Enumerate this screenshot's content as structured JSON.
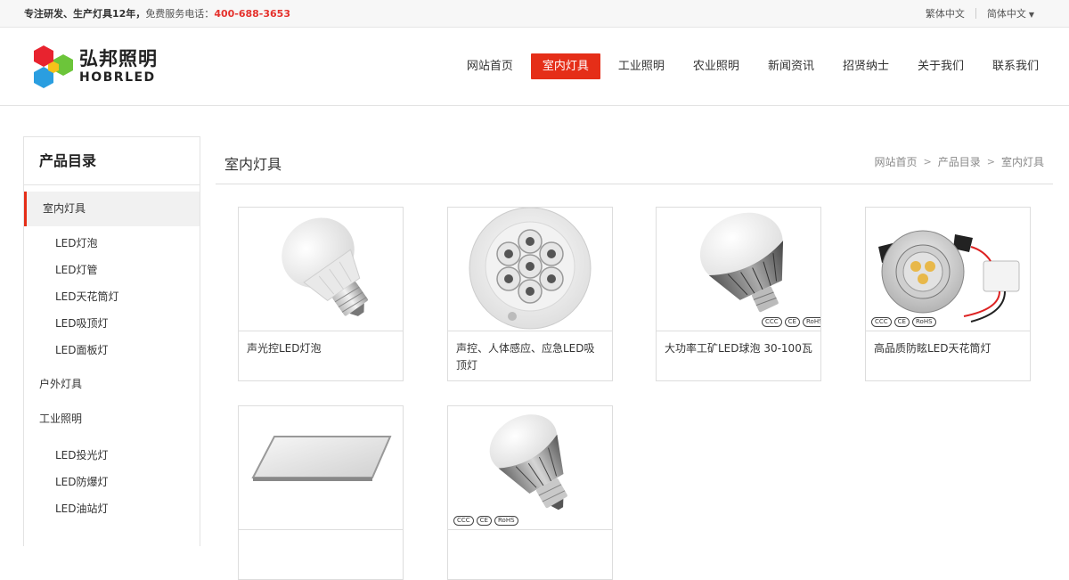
{
  "topbar": {
    "slogan": "专注研发、生产灯具12年，",
    "hotline_label": "免费服务电话：",
    "phone": "400-688-3653",
    "lang_trad": "繁体中文",
    "lang_simp": "简体中文"
  },
  "logo": {
    "cn": "弘邦照明",
    "en": "HOBRLED"
  },
  "nav": [
    {
      "label": "网站首页"
    },
    {
      "label": "室内灯具"
    },
    {
      "label": "工业照明"
    },
    {
      "label": "农业照明"
    },
    {
      "label": "新闻资讯"
    },
    {
      "label": "招贤纳士"
    },
    {
      "label": "关于我们"
    },
    {
      "label": "联系我们"
    }
  ],
  "sidebar": {
    "title": "产品目录",
    "items": [
      {
        "label": "室内灯具"
      },
      {
        "label": "LED灯泡"
      },
      {
        "label": "LED灯管"
      },
      {
        "label": "LED天花筒灯"
      },
      {
        "label": "LED吸顶灯"
      },
      {
        "label": "LED面板灯"
      },
      {
        "label": "户外灯具"
      },
      {
        "label": "工业照明"
      },
      {
        "label": "LED投光灯"
      },
      {
        "label": "LED防爆灯"
      },
      {
        "label": "LED油站灯"
      }
    ]
  },
  "main": {
    "title": "室内灯具",
    "breadcrumb": [
      "网站首页",
      "产品目录",
      "室内灯具"
    ],
    "products": [
      {
        "name": "声光控LED灯泡"
      },
      {
        "name": "声控、人体感应、应急LED吸顶灯"
      },
      {
        "name": "大功率工矿LED球泡 30-100瓦"
      },
      {
        "name": "高品质防眩LED天花筒灯"
      },
      {
        "name": ""
      },
      {
        "name": ""
      }
    ],
    "cert_labels": [
      "CCC",
      "CE",
      "RoHS"
    ]
  },
  "colors": {
    "accent": "#e52e18",
    "phone": "#e5322d"
  }
}
